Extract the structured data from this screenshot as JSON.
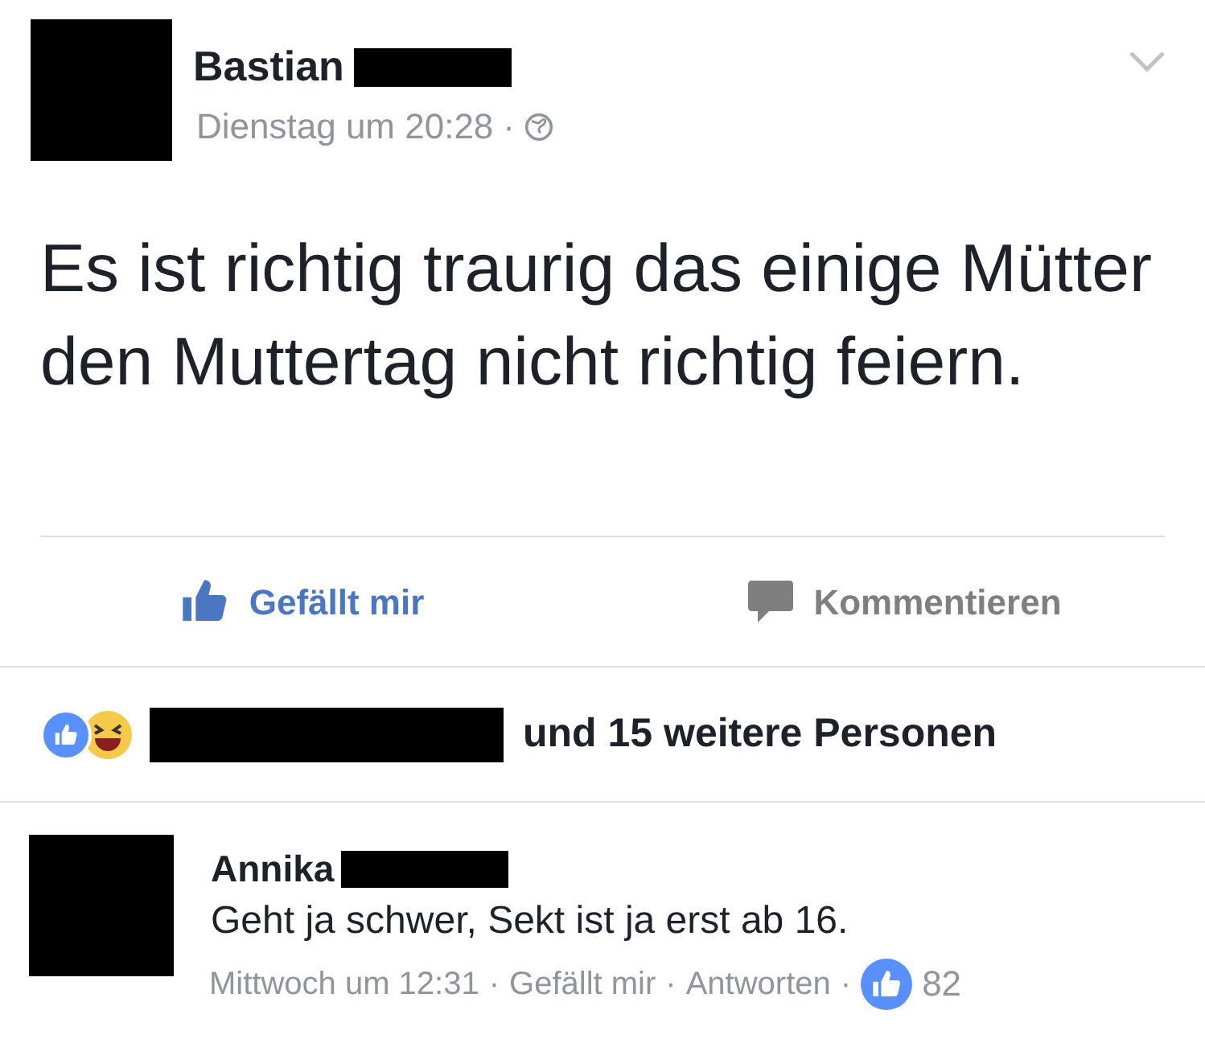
{
  "post": {
    "author": "Bastian",
    "timestamp": "Dienstag um 20:28",
    "separator": "·",
    "text": "Es ist richtig traurig das einige Mütter den Muttertag nicht richtig feiern."
  },
  "actions": [
    {
      "kind": "like",
      "label": "Gefällt mir"
    },
    {
      "kind": "comment",
      "label": "Kommentieren"
    }
  ],
  "reactions": {
    "summary": "und 15 weitere Personen"
  },
  "comment": {
    "author": "Annika",
    "text": "Geht ja schwer, Sekt ist ja erst ab 16.",
    "timestamp": "Mittwoch um 12:31",
    "links": [
      "Gefällt mir",
      "Antworten"
    ],
    "separator": "·",
    "likes": "82"
  }
}
